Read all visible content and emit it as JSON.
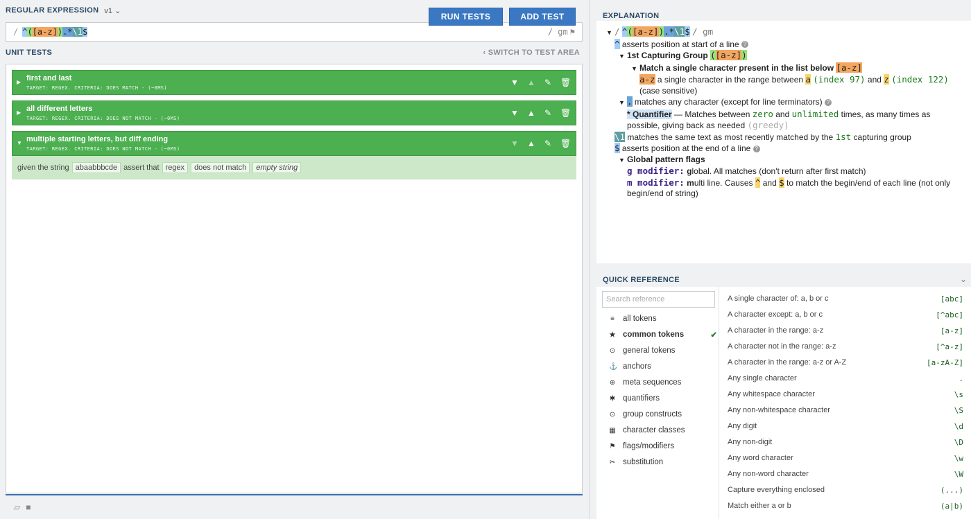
{
  "regex_section": {
    "title": "REGULAR EXPRESSION",
    "version": "v1",
    "open_slash": "/",
    "close_flags": "/ gm"
  },
  "regex": {
    "anchor_start": "^",
    "group_open": "(",
    "set": "[a-z]",
    "group_close": ")",
    "dot_star": ".*",
    "backref": "\\1",
    "anchor_end": "$"
  },
  "unit_tests": {
    "title": "UNIT TESTS",
    "switch_label": "SWITCH TO TEST AREA",
    "tests": [
      {
        "name": "first and last",
        "meta": "TARGET: REGEX. CRITERIA: DOES MATCH - (~0MS)"
      },
      {
        "name": "all different letters",
        "meta": "TARGET: REGEX. CRITERIA: DOES NOT MATCH - (~0MS)"
      },
      {
        "name": "multiple starting letters, but diff ending",
        "meta": "TARGET: REGEX. CRITERIA: DOES NOT MATCH - (~0MS)"
      }
    ],
    "detail": {
      "given": "given the string",
      "string": "abaabbbcde",
      "assert": "assert that",
      "target": "regex",
      "criteria": "does not match",
      "result": "empty string"
    },
    "run_label": "RUN TESTS",
    "add_label": "ADD TEST"
  },
  "explanation": {
    "title": "EXPLANATION",
    "top_flags": "/ gm",
    "r1": "asserts position at start of a line",
    "r2_label": "1st Capturing Group",
    "r3_label": "Match a single character present in the list below",
    "r4_a": "a single character in the range between",
    "r4_achar": "a",
    "r4_aidx": "(index 97)",
    "r4_and": "and",
    "r4_zchar": "z",
    "r4_zidx": "(index 122)",
    "r5": "(case sensitive)",
    "r6": "matches any character (except for line terminators)",
    "r7_q": "* Quantifier",
    "r7_a": "— Matches between",
    "r7_zero": "zero",
    "r7_and": "and",
    "r7_unl": "unlimited",
    "r7_b": "times, as many times as",
    "r8": "possible, giving back as needed",
    "r8_g": "(greedy)",
    "r9_a": "matches the same text as most recently matched by the",
    "r9_1st": "1st",
    "r9_b": "capturing group",
    "r10": "asserts position at the end of a line",
    "r11": "Global pattern flags",
    "r12_mod": "g modifier:",
    "r12_g": "g",
    "r12_rest": "lobal. All matches (don't return after first match)",
    "r13_mod": "m modifier:",
    "r13_m": "m",
    "r13_a": "ulti line. Causes",
    "r13_and": "and",
    "r13_b": "to match the begin/end of each line (not only",
    "r14": "begin/end of string)"
  },
  "quick_reference": {
    "title": "QUICK REFERENCE",
    "search_placeholder": "Search reference",
    "categories": [
      {
        "label": "all tokens",
        "icon": "database-icon"
      },
      {
        "label": "common tokens",
        "icon": "star-icon"
      },
      {
        "label": "general tokens",
        "icon": "circle-dot-icon"
      },
      {
        "label": "anchors",
        "icon": "anchor-icon"
      },
      {
        "label": "meta sequences",
        "icon": "globe-icon"
      },
      {
        "label": "quantifiers",
        "icon": "asterisk-icon"
      },
      {
        "label": "group constructs",
        "icon": "circle-dot-icon"
      },
      {
        "label": "character classes",
        "icon": "grid-icon"
      },
      {
        "label": "flags/modifiers",
        "icon": "flag-icon"
      },
      {
        "label": "substitution",
        "icon": "scissors-icon"
      }
    ],
    "active_category": "common tokens",
    "refs": [
      {
        "desc": "A single character of: a, b or c",
        "code": "[abc]"
      },
      {
        "desc": "A character except: a, b or c",
        "code": "[^abc]"
      },
      {
        "desc": "A character in the range: a-z",
        "code": "[a-z]"
      },
      {
        "desc": "A character not in the range: a-z",
        "code": "[^a-z]"
      },
      {
        "desc": "A character in the range: a-z or A-Z",
        "code": "[a-zA-Z]"
      },
      {
        "desc": "Any single character",
        "code": "."
      },
      {
        "desc": "Any whitespace character",
        "code": "\\s"
      },
      {
        "desc": "Any non-whitespace character",
        "code": "\\S"
      },
      {
        "desc": "Any digit",
        "code": "\\d"
      },
      {
        "desc": "Any non-digit",
        "code": "\\D"
      },
      {
        "desc": "Any word character",
        "code": "\\w"
      },
      {
        "desc": "Any non-word character",
        "code": "\\W"
      },
      {
        "desc": "Capture everything enclosed",
        "code": "(...)"
      },
      {
        "desc": "Match either a or b",
        "code": "(a|b)"
      }
    ]
  }
}
